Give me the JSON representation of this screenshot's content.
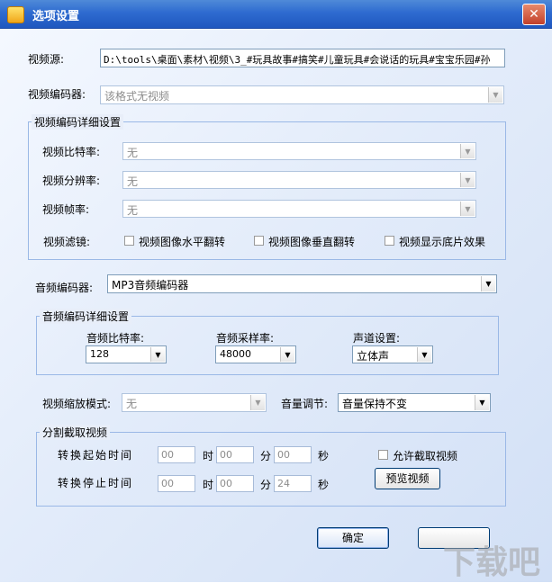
{
  "window": {
    "title": "选项设置",
    "close_glyph": "✕"
  },
  "video_source": {
    "label": "视频源:",
    "value": "D:\\tools\\桌面\\素材\\视频\\3_#玩具故事#搞笑#儿童玩具#会说话的玩具#宝宝乐园#孙"
  },
  "video_encoder": {
    "label": "视频编码器:",
    "value": "该格式无视频"
  },
  "video_detail": {
    "legend": "视频编码详细设置",
    "bitrate": {
      "label": "视频比特率:",
      "value": "无"
    },
    "resolution": {
      "label": "视频分辨率:",
      "value": "无"
    },
    "framerate": {
      "label": "视频帧率:",
      "value": "无"
    },
    "filter": {
      "label": "视频滤镜:",
      "options": [
        "视频图像水平翻转",
        "视频图像垂直翻转",
        "视频显示底片效果"
      ]
    }
  },
  "audio_encoder": {
    "label": "音频编码器:",
    "value": "MP3音频编码器"
  },
  "audio_detail": {
    "legend": "音频编码详细设置",
    "bitrate": {
      "label": "音频比特率:",
      "value": "128"
    },
    "samplerate": {
      "label": "音频采样率:",
      "value": "48000"
    },
    "channel": {
      "label": "声道设置:",
      "value": "立体声"
    }
  },
  "scale": {
    "label": "视频缩放模式:",
    "value": "无"
  },
  "volume": {
    "label": "音量调节:",
    "value": "音量保持不变"
  },
  "trim": {
    "legend": "分割截取视频",
    "start_label": "转换起始时间",
    "end_label": "转换停止时间",
    "unit_h": "时",
    "unit_m": "分",
    "unit_s": "秒",
    "start": {
      "h": "00",
      "m": "00",
      "s": "00"
    },
    "end": {
      "h": "00",
      "m": "00",
      "s": "24"
    },
    "allow_label": "允许截取视频",
    "preview_label": "预览视频"
  },
  "buttons": {
    "ok": "确定"
  },
  "watermark": {
    "text": "下载吧"
  },
  "colors": {
    "titlebar": "#2e6bd0",
    "group_border": "#9ab8e6",
    "client_bg": "#e3ecfa"
  },
  "icons": [
    "app-icon",
    "close-icon",
    "dropdown-arrow-icon",
    "checkbox-icon"
  ]
}
